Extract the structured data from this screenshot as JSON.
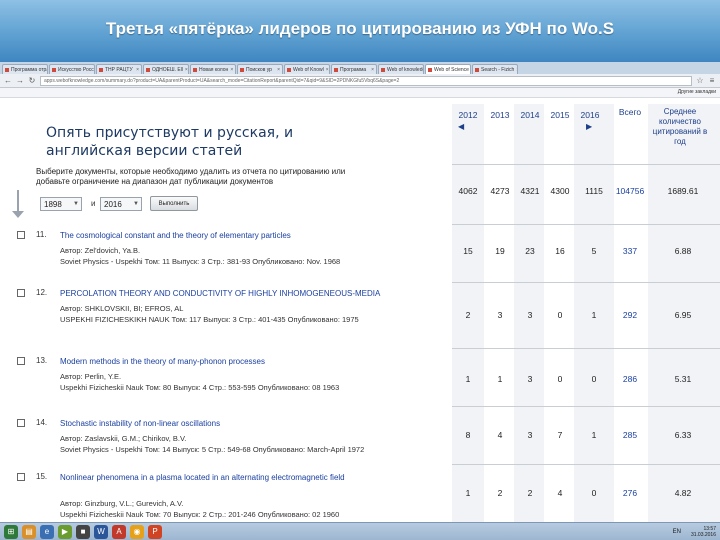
{
  "slide": {
    "title": "Третья «пятёрка» лидеров по цитированию из УФН по Wo.S"
  },
  "browser": {
    "tabs": [
      {
        "label": "Программа отрас",
        "active": false
      },
      {
        "label": "Искусство Россия",
        "active": false
      },
      {
        "label": "ТНР РАЦТУ",
        "active": false
      },
      {
        "label": "ОДНОЕШ. Ell",
        "active": false
      },
      {
        "label": "Новая колон",
        "active": false
      },
      {
        "label": "Поисков ур",
        "active": false
      },
      {
        "label": "Web of Knowl",
        "active": false
      },
      {
        "label": "Программа",
        "active": false
      },
      {
        "label": "Web of knowledge",
        "active": false
      },
      {
        "label": "Web of Science",
        "active": true
      },
      {
        "label": "Search - Fizich",
        "active": false
      }
    ],
    "url": "apps.webofknowledge.com/summary.do?product=UA&parentProduct=UA&search_mode=CitationReport&parentQid=7&qid=9&SID=2PDNKGfu5Vbq6S&page=2",
    "bookmarks_label": "Другие закладки"
  },
  "annotation": {
    "line1": "Опять присутствуют и русская, и",
    "line2": "английская версии статей"
  },
  "filter": {
    "instruction": "Выберите документы, которые необходимо удалить из отчета по цитированию или добавьте ограничение на диапазон дат публикации документов",
    "from_year": "1898",
    "and_label": "и",
    "to_year": "2016",
    "apply_label": "Выполнить"
  },
  "records": [
    {
      "num": "11.",
      "title": "The cosmological constant and the theory of elementary particles",
      "lines": [
        "Автор: Zel'dovich, Ya.B.",
        "Soviet Physics - Uspekhi  Том: 11   Выпуск: 3   Стр.: 381-93   Опубликовано: Nov. 1968"
      ]
    },
    {
      "num": "12.",
      "title": "PERCOLATION THEORY AND CONDUCTIVITY OF HIGHLY INHOMOGENEOUS-MEDIA",
      "lines": [
        "Автор: SHKLOVSKII, BI; EFROS, AL",
        "USPEKHI FIZICHESKIKH NAUK  Том: 117   Выпуск: 3   Стр.: 401-435   Опубликовано: 1975"
      ]
    },
    {
      "num": "13.",
      "title": "Modern methods in the theory of many-phonon processes",
      "lines": [
        "Автор: Perlin, Y.E.",
        "Uspekhi Fizicheskii Nauk  Том: 80   Выпуск: 4   Стр.: 553-595   Опубликовано: 08 1963"
      ]
    },
    {
      "num": "14.",
      "title": "Stochastic instability of non-linear oscillations",
      "lines": [
        "Автор: Zaslavskii, G.M.; Chirikov, B.V.",
        "Soviet Physics - Uspekhi  Том: 14   Выпуск: 5   Стр.: 549-68   Опубликовано: March-April 1972"
      ]
    },
    {
      "num": "15.",
      "title": "Nonlinear phenomena in a plasma located in an alternating electromagnetic field",
      "lines": [
        "Автор: Ginzburg, V.L.; Gurevich, A.V.",
        "Uspekhi Fizicheskii Nauk  Том: 70   Выпуск: 2   Стр.: 201-246   Опубликовано: 02 1960"
      ]
    }
  ],
  "citation_table": {
    "years": [
      "2012",
      "2013",
      "2014",
      "2015",
      "2016"
    ],
    "total_label": "Всего",
    "avg_label": "Среднее количество цитирований в год",
    "totals_row": [
      "4062",
      "4273",
      "4321",
      "4300",
      "1115",
      "104756",
      "1689.61"
    ],
    "rows": [
      [
        "15",
        "19",
        "23",
        "16",
        "5",
        "337",
        "6.88"
      ],
      [
        "2",
        "3",
        "3",
        "0",
        "1",
        "292",
        "6.95"
      ],
      [
        "1",
        "1",
        "3",
        "0",
        "0",
        "286",
        "5.31"
      ],
      [
        "8",
        "4",
        "3",
        "7",
        "1",
        "285",
        "6.33"
      ],
      [
        "1",
        "2",
        "2",
        "4",
        "0",
        "276",
        "4.82"
      ]
    ]
  },
  "taskbar": {
    "lang": "EN",
    "time": "13:57",
    "date": "31.03.2016"
  },
  "colors": {
    "title_bg": "#5fa1d2",
    "link": "#1a3fa0",
    "annotation": "#1e3a64"
  }
}
